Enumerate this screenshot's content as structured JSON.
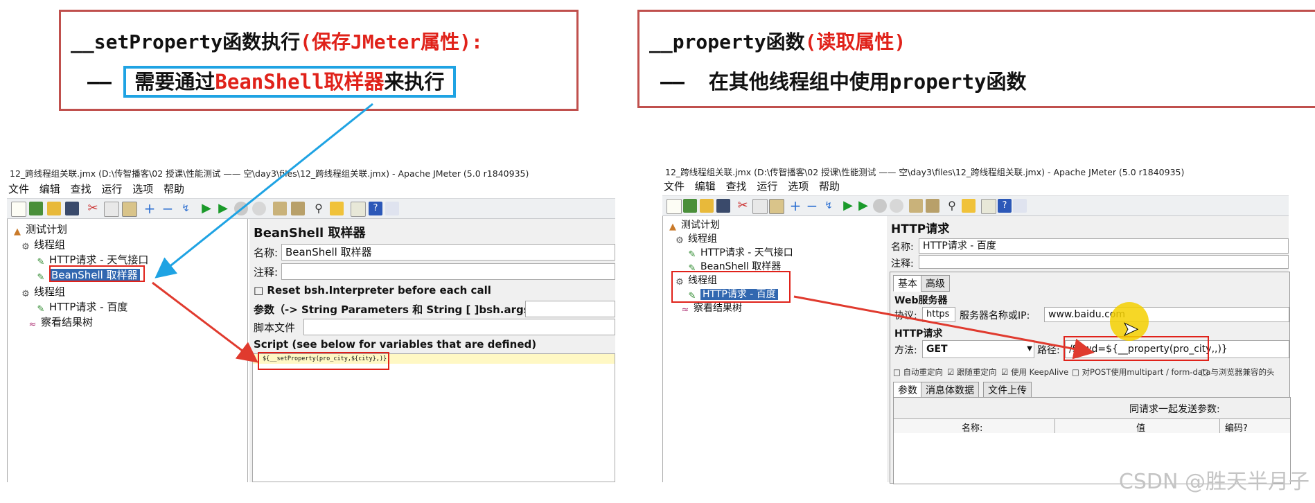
{
  "callout_left": {
    "line1_prefix": "__setProperty函数执行",
    "line1_highlight": "(保存JMeter属性):",
    "line2_dash": "——",
    "line2_a": "需要通过",
    "line2_b": "BeanShell取样器",
    "line2_c": "来执行"
  },
  "callout_right": {
    "line1_prefix": "__property函数",
    "line1_highlight": "(读取属性)",
    "line2_dash": "——",
    "line2": "在其他线程组中使用property函数"
  },
  "left_window": {
    "title": "12_跨线程组关联.jmx (D:\\传智播客\\02 授课\\性能测试 —— 空\\day3\\files\\12_跨线程组关联.jmx) - Apache JMeter (5.0 r1840935)",
    "menu": [
      "文件",
      "编辑",
      "查找",
      "运行",
      "选项",
      "帮助"
    ],
    "tree": {
      "test_plan": "测试计划",
      "thread_group_1": "线程组",
      "http_weather": "HTTP请求 - 天气接口",
      "beanshell": "BeanShell 取样器",
      "thread_group_2": "线程组",
      "http_baidu": "HTTP请求 - 百度",
      "result_tree": "察看结果树"
    },
    "panel": {
      "heading": "BeanShell 取样器",
      "name_label": "名称:",
      "name_value": "BeanShell 取样器",
      "comment_label": "注释:",
      "reset_label": "Reset bsh.Interpreter before each call",
      "params_label": "参数（-> String Parameters 和 String [ ]bsh.args）",
      "script_file_label": "脚本文件",
      "script_label": "Script (see below for variables that are defined)",
      "script_code": "${__setProperty(pro_city,${city},)}"
    }
  },
  "right_window": {
    "title": "12_跨线程组关联.jmx (D:\\传智播客\\02 授课\\性能测试 —— 空\\day3\\files\\12_跨线程组关联.jmx) - Apache JMeter (5.0 r1840935)",
    "menu": [
      "文件",
      "编辑",
      "查找",
      "运行",
      "选项",
      "帮助"
    ],
    "tree": {
      "test_plan": "测试计划",
      "thread_group_1": "线程组",
      "http_weather": "HTTP请求 - 天气接口",
      "beanshell": "BeanShell 取样器",
      "thread_group_2": "线程组",
      "http_baidu": "HTTP请求 - 百度",
      "result_tree": "察看结果树"
    },
    "panel": {
      "heading": "HTTP请求",
      "name_label": "名称:",
      "name_value": "HTTP请求 - 百度",
      "comment_label": "注释:",
      "tab_basic": "基本",
      "tab_advanced": "高级",
      "web_server": "Web服务器",
      "protocol_label": "协议:",
      "protocol_value": "https",
      "server_label": "服务器名称或IP:",
      "server_value": "www.baidu.com",
      "http_request": "HTTP请求",
      "method_label": "方法:",
      "method_value": "GET",
      "path_label": "路径:",
      "path_value": "/S?wd=${__property(pro_city,,)}",
      "opt_redirect_auto": "自动重定向",
      "opt_follow_redirects": "跟随重定向",
      "opt_keepalive": "使用 KeepAlive",
      "opt_multipart": "对POST使用multipart / form-data",
      "opt_browser_headers": "与浏览器兼容的头",
      "tab_params": "参数",
      "tab_body": "消息体数据",
      "tab_files": "文件上传",
      "send_params": "同请求一起发送参数:",
      "col_name": "名称:",
      "col_value": "值",
      "col_encode": "编码?"
    }
  },
  "watermark": "CSDN @胜天半月子",
  "colors": {
    "callout_border": "#c0504d",
    "highlight": "#e0221a",
    "blue_box": "#1fa3e3"
  }
}
